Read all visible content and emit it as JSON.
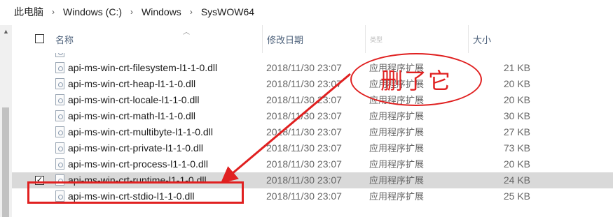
{
  "breadcrumb": [
    "此电脑",
    "Windows (C:)",
    "Windows",
    "SysWOW64"
  ],
  "breadcrumb_separator": "›",
  "columns": {
    "name": "名称",
    "date": "修改日期",
    "type": "类型",
    "size": "大小"
  },
  "files": [
    {
      "name": "api-ms-win-crt-filesystem-l1-1-0.dll",
      "date": "2018/11/30 23:07",
      "type": "应用程序扩展",
      "size": "21 KB",
      "selected": false
    },
    {
      "name": "api-ms-win-crt-heap-l1-1-0.dll",
      "date": "2018/11/30 23:07",
      "type": "应用程序扩展",
      "size": "20 KB",
      "selected": false
    },
    {
      "name": "api-ms-win-crt-locale-l1-1-0.dll",
      "date": "2018/11/30 23:07",
      "type": "应用程序扩展",
      "size": "20 KB",
      "selected": false
    },
    {
      "name": "api-ms-win-crt-math-l1-1-0.dll",
      "date": "2018/11/30 23:07",
      "type": "应用程序扩展",
      "size": "30 KB",
      "selected": false
    },
    {
      "name": "api-ms-win-crt-multibyte-l1-1-0.dll",
      "date": "2018/11/30 23:07",
      "type": "应用程序扩展",
      "size": "27 KB",
      "selected": false
    },
    {
      "name": "api-ms-win-crt-private-l1-1-0.dll",
      "date": "2018/11/30 23:07",
      "type": "应用程序扩展",
      "size": "73 KB",
      "selected": false
    },
    {
      "name": "api-ms-win-crt-process-l1-1-0.dll",
      "date": "2018/11/30 23:07",
      "type": "应用程序扩展",
      "size": "20 KB",
      "selected": false
    },
    {
      "name": "api-ms-win-crt-runtime-l1-1-0.dll",
      "date": "2018/11/30 23:07",
      "type": "应用程序扩展",
      "size": "24 KB",
      "selected": true
    },
    {
      "name": "api-ms-win-crt-stdio-l1-1-0.dll",
      "date": "2018/11/30 23:07",
      "type": "应用程序扩展",
      "size": "25 KB",
      "selected": false
    }
  ],
  "annotation": {
    "text": "删了它",
    "color": "#e02020"
  },
  "icons": {
    "file": "dll-file-icon",
    "sort": "sort-up-caret-icon",
    "scroll_up": "scroll-up-arrow-icon"
  },
  "colors": {
    "selected_row": "#d9d9d9",
    "header_text": "#4c607a",
    "annotation": "#e02020"
  }
}
